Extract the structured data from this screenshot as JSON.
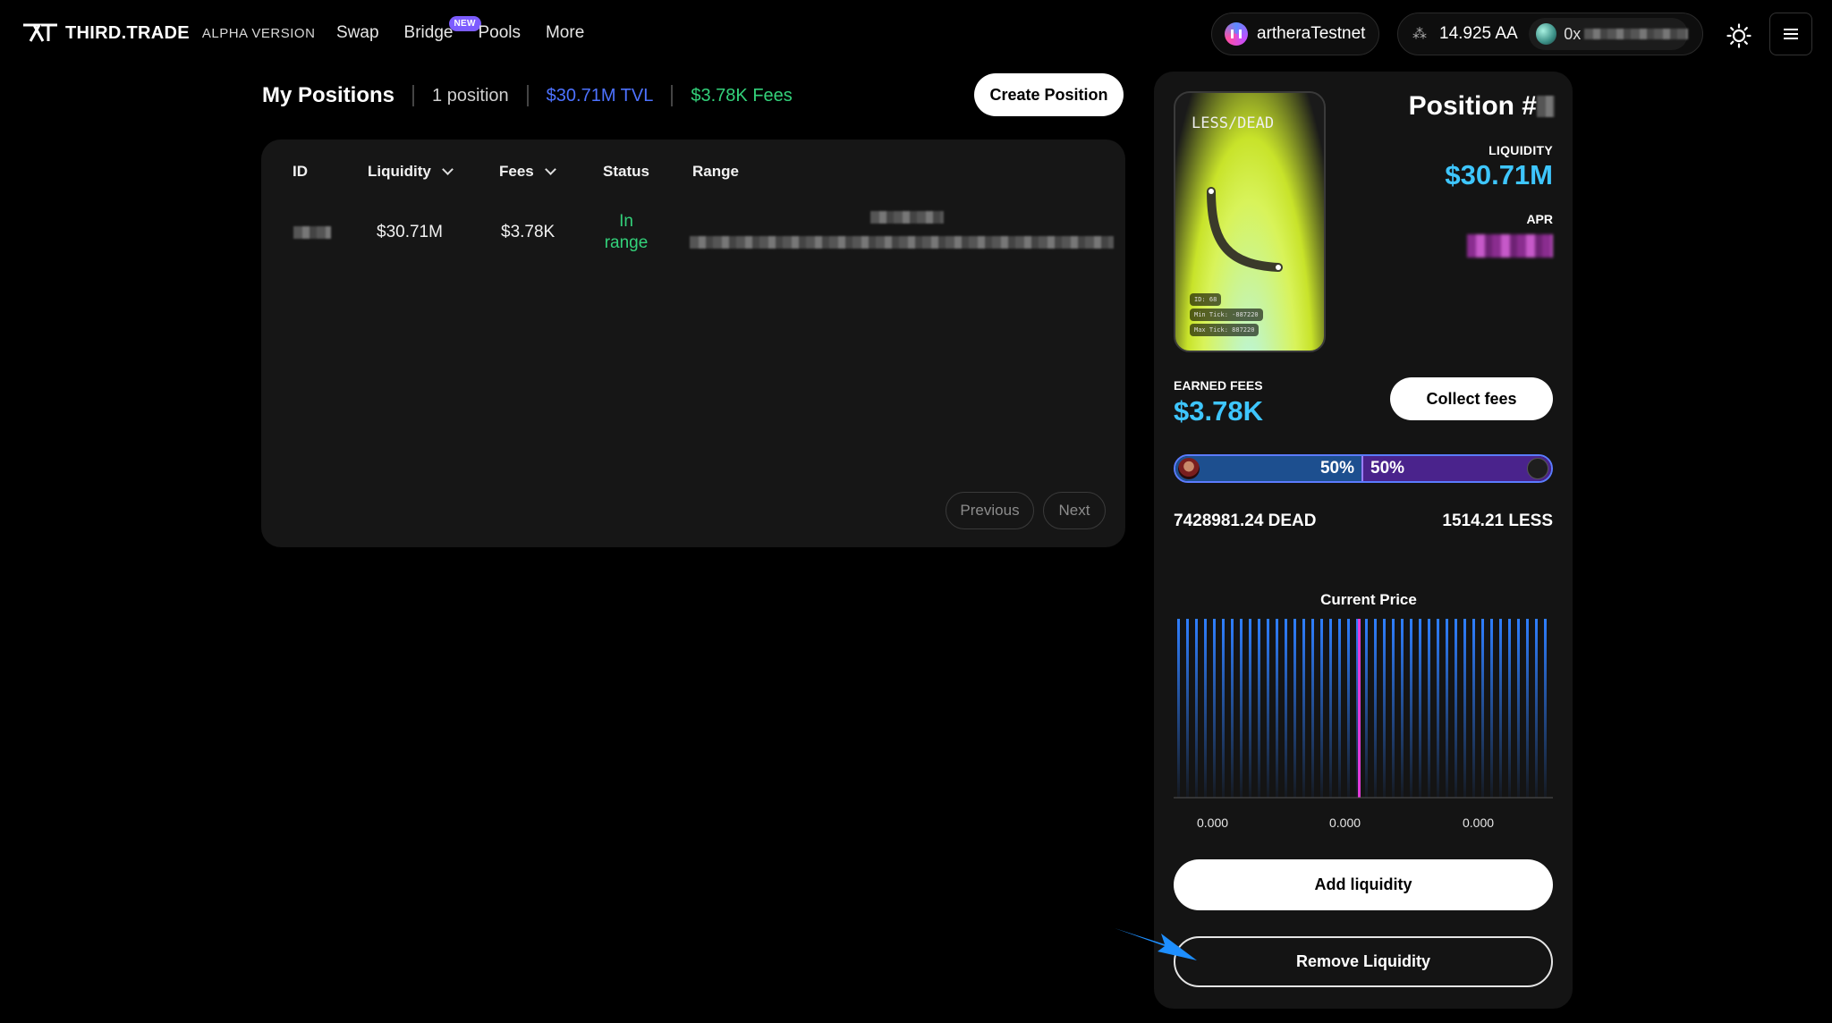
{
  "app": {
    "logo_text": "THIRD.TRADE",
    "version_label": "ALPHA VERSION"
  },
  "nav": {
    "items": [
      "Swap",
      "Bridge",
      "Pools",
      "More"
    ],
    "bridge_badge": "NEW"
  },
  "header": {
    "network": "artheraTestnet",
    "balance": "14.925 AA",
    "address_prefix": "0x"
  },
  "positions": {
    "title": "My Positions",
    "count": "1 position",
    "tvl": "$30.71M TVL",
    "fees": "$3.78K Fees",
    "create_label": "Create Position"
  },
  "table": {
    "columns": [
      "ID",
      "Liquidity",
      "Fees",
      "Status",
      "Range"
    ],
    "rows": [
      {
        "liquidity": "$30.71M",
        "fees": "$3.78K",
        "status": "In range"
      }
    ],
    "previous_label": "Previous",
    "next_label": "Next"
  },
  "detail": {
    "nft_pair": "LESS/DEAD",
    "nft_id": "ID: 68",
    "nft_min_tick": "Min Tick: -887220",
    "nft_max_tick": "Max Tick: 887220",
    "position_label": "Position #",
    "liquidity_label": "LIQUIDITY",
    "liquidity_value": "$30.71M",
    "apr_label": "APR",
    "earned_fees_label": "EARNED FEES",
    "earned_fees_value": "$3.78K",
    "collect_label": "Collect fees",
    "ratio_a": "50%",
    "ratio_b": "50%",
    "amount_a": "7428981.24 DEAD",
    "amount_b": "1514.21 LESS",
    "current_price_label": "Current Price",
    "price_ticks": [
      "0.000",
      "0.000",
      "0.000"
    ],
    "add_label": "Add liquidity",
    "remove_label": "Remove Liquidity"
  },
  "colors": {
    "accent_blue": "#3ec6ff",
    "tvl_blue": "#4d72ff",
    "green": "#33d17a",
    "price_line": "#e23ad8",
    "bar_blue": "#2f7fff"
  },
  "icons": [
    "gas-icon",
    "sun-icon",
    "menu-icon",
    "chevron-down-icon",
    "arrow-pointer-icon"
  ]
}
